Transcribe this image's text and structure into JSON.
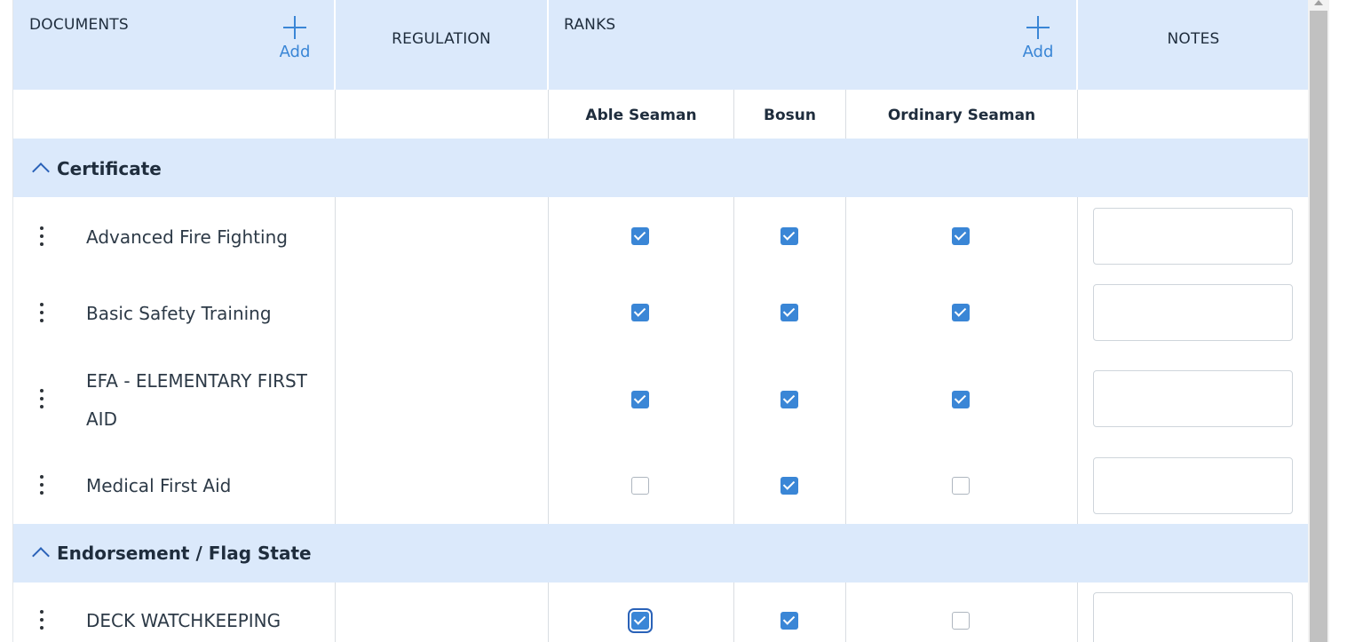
{
  "header": {
    "documents_title": "DOCUMENTS",
    "regulation_title": "REGULATION",
    "ranks_title": "RANKS",
    "notes_title": "NOTES",
    "add_document_label": "Add",
    "add_rank_label": "Add"
  },
  "ranks": [
    "Able Seaman",
    "Bosun",
    "Ordinary Seaman"
  ],
  "groups": [
    {
      "title": "Certificate",
      "rows": [
        {
          "document": "Advanced Fire Fighting",
          "regulation": "",
          "checks": [
            true,
            true,
            true
          ],
          "note": ""
        },
        {
          "document": "Basic Safety Training",
          "regulation": "",
          "checks": [
            true,
            true,
            true
          ],
          "note": ""
        },
        {
          "document": "EFA - ELEMENTARY FIRST AID",
          "regulation": "",
          "checks": [
            true,
            true,
            true
          ],
          "note": ""
        },
        {
          "document": "Medical First Aid",
          "regulation": "",
          "checks": [
            false,
            true,
            false
          ],
          "note": ""
        }
      ]
    },
    {
      "title": "Endorsement / Flag State",
      "rows": [
        {
          "document": "DECK WATCHKEEPING",
          "regulation": "",
          "checks": [
            true,
            true,
            false
          ],
          "note": "",
          "focused_check": 0
        }
      ]
    }
  ],
  "colors": {
    "header_bg": "#dbe9fb",
    "accent": "#3a86d6",
    "chevron": "#2a62b8"
  },
  "icons": {
    "add": "plus-icon",
    "row_menu": "kebab-menu-icon",
    "group_toggle": "chevron-up-icon"
  }
}
